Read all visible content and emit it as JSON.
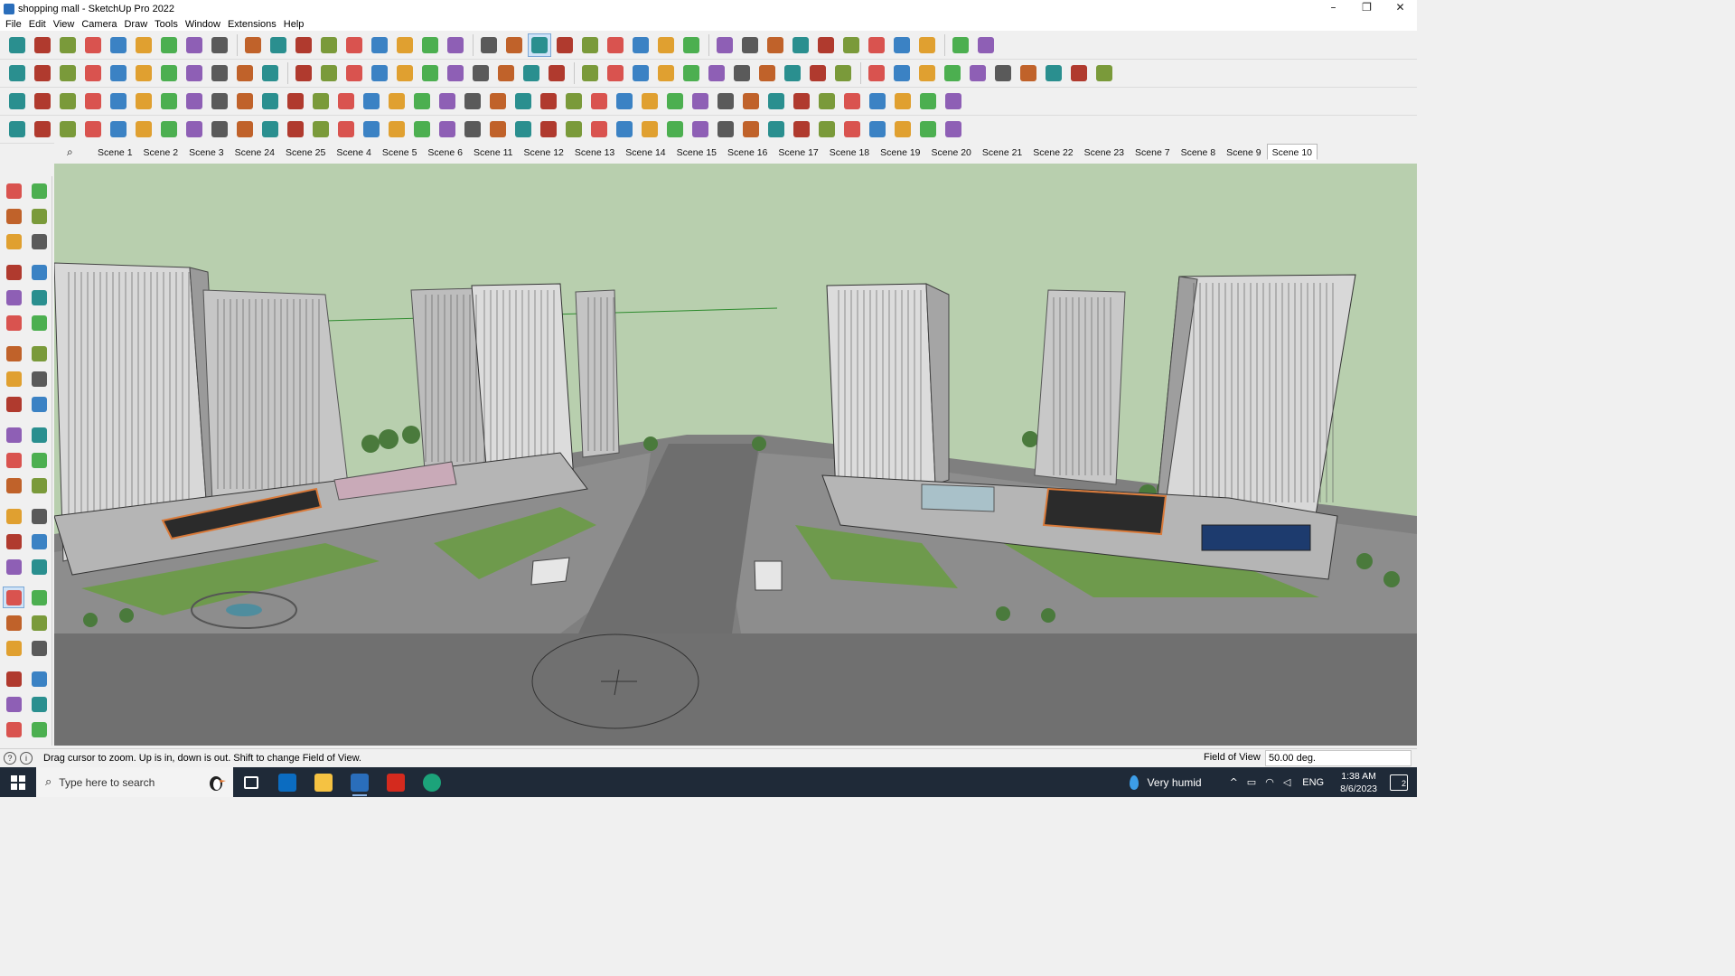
{
  "window": {
    "title": "shopping mall - SketchUp Pro 2022",
    "controls": [
      "–",
      "❐",
      "✕"
    ]
  },
  "menu": [
    "File",
    "Edit",
    "View",
    "Camera",
    "Draw",
    "Tools",
    "Window",
    "Extensions",
    "Help"
  ],
  "toolbars": {
    "row1_icons": [
      "zoom-search-icon",
      "select-icon",
      "select-dropdown-icon",
      "eraser-icon",
      "pencil-icon",
      "pencil-dropdown-icon",
      "freehand-icon",
      "freehand-dropdown-icon",
      "rectangle-icon",
      "rectangle-dropdown-icon",
      "push-pull-icon",
      "follow-me-icon",
      "move-icon",
      "rotate-icon",
      "scale-icon",
      "tape-measure-icon",
      "text-icon",
      "paint-bucket-icon",
      "orbit-icon",
      "pan-icon",
      "zoom-icon",
      "zoom-extents-icon",
      "warehouse-icon",
      "sandbox-icon",
      "layers-icon",
      "components-icon",
      "user-account-icon",
      "user-dropdown-icon",
      "flag-icon",
      "style-icon",
      "axes-icon",
      "push-up-icon",
      "push-down-icon",
      "measure-icon",
      "section-icon",
      "undo-icon",
      "redo-icon",
      "eraser-red-icon"
    ],
    "row2_icons": [
      "cube-yellow-icon",
      "cube-gray-icon",
      "cube-tan-icon",
      "extrude-icon",
      "extrude-alt-icon",
      "extrude-blue-icon",
      "extrude-green-icon",
      "extrude-red-icon",
      "extrude-orange-icon",
      "extrude-purple-icon",
      "curve-icon",
      "section-plane-icon",
      "section-cut-icon",
      "section-fill-icon",
      "terrain-icon",
      "tree-icon",
      "house-icon",
      "house-alt-icon",
      "house-outline-icon",
      "garage-icon",
      "building-icon",
      "text-fx-icon",
      "tag-icon",
      "ruler-icon",
      "shape-a-icon",
      "circle-icon",
      "pentagon-icon",
      "ellipse-icon",
      "parallelogram-icon",
      "arc-shape-icon",
      "polygon-icon",
      "star-icon",
      "loop-icon",
      "spiral-icon",
      "line-red-icon",
      "eraser-pink-icon",
      "brick-icon",
      "grid-icon",
      "shape-tool-icon",
      "shape-tool-alt-icon",
      "shape-tool-glove-icon",
      "shape-tool-dark-icon",
      "shape-tool-red-icon"
    ],
    "row3_icons": [
      "solid-red-icon",
      "solid-blue-icon",
      "solid-yellow-icon",
      "solid-green-icon",
      "solid-red-alt-icon",
      "solid-white-icon",
      "arc-orange-icon",
      "box-red-icon",
      "panel-icon",
      "wood-icon",
      "pipe-icon",
      "bend-icon",
      "nodes-icon",
      "plus-red-icon",
      "plus-green-icon",
      "x-blue-icon",
      "lamp-icon",
      "cone-icon",
      "triangle-icon",
      "loop-orange-icon",
      "loop-x-icon",
      "ring-icon",
      "star-blue-icon",
      "bucket-icon",
      "magnet-icon",
      "tree-green-icon",
      "chain-icon",
      "plugin-a-icon",
      "plugin-b-icon",
      "plugin-c-icon",
      "cog-icon",
      "frame-icon",
      "grid-orange-icon",
      "grid-orange-alt-icon",
      "grid-yellow-icon",
      "points-red-icon",
      "circle-dots-icon",
      "blocks-icon"
    ],
    "row4_icons": [
      "edit-node-icon",
      "spline-icon",
      "curve-red-icon",
      "cross-line-icon",
      "weld-icon",
      "rotate-3d-icon",
      "tube-icon",
      "mesh-icon",
      "twist-icon",
      "corner-a-icon",
      "corner-b-icon",
      "line-cut-icon",
      "slice-icon",
      "knife-icon",
      "stairs-icon",
      "rail-icon",
      "hand-icon",
      "shell-icon",
      "leaf-icon",
      "stack-icon",
      "fence-icon",
      "ramp-a-icon",
      "ramp-b-icon",
      "ramp-c-icon",
      "tile-a-icon",
      "tile-b-icon",
      "wall-a-icon",
      "wall-b-icon",
      "wall-c-icon",
      "hatch-a-icon",
      "hatch-b-icon",
      "hatch-c-icon",
      "hatch-d-icon",
      "hatch-e-icon",
      "hatch-f-icon",
      "hatch-g-icon",
      "hatch-h-icon",
      "cube-outline-icon"
    ]
  },
  "scenes": {
    "tabs": [
      "Scene 1",
      "Scene 2",
      "Scene 3",
      "Scene 24",
      "Scene 25",
      "Scene 4",
      "Scene 5",
      "Scene 6",
      "Scene 11",
      "Scene 12",
      "Scene 13",
      "Scene 14",
      "Scene 15",
      "Scene 16",
      "Scene 17",
      "Scene 18",
      "Scene 19",
      "Scene 20",
      "Scene 21",
      "Scene 22",
      "Scene 23",
      "Scene 7",
      "Scene 8",
      "Scene 9",
      "Scene 10"
    ],
    "active": "Scene 10"
  },
  "left_palette": [
    "select-icon",
    "orbit-icon",
    "paint-bucket-icon",
    "eraser-icon",
    "components-icon",
    "pencil-icon",
    "line-icon",
    "freehand-icon",
    "rectangle-icon",
    "rotated-rectangle-icon",
    "circle-icon",
    "polygon-icon",
    "arc-icon",
    "two-point-arc-icon",
    "pie-icon",
    "three-point-arc-icon",
    "move-icon",
    "push-pull-icon",
    "rotate-icon",
    "follow-me-icon",
    "scale-icon",
    "offset-icon",
    "tape-measure-icon",
    "dimension-icon",
    "protractor-icon",
    "text-icon",
    "axes-icon",
    "3d-text-icon",
    "orbit-tool-icon",
    "pan-icon",
    "zoom-icon",
    "zoom-window-icon",
    "zoom-extents-icon",
    "previous-view-icon",
    "position-camera-icon",
    "look-around-icon",
    "walk-icon",
    "section-plane-icon",
    "warehouse-icon",
    "sandbox-icon",
    "extension-warehouse-icon",
    "layout-icon"
  ],
  "status": {
    "message": "Drag cursor to zoom.  Up is in, down is out. Shift to change Field of View.",
    "fov_label": "Field of View",
    "fov_value": "50.00 deg."
  },
  "taskbar": {
    "search_placeholder": "Type here to search",
    "weather": "Very humid",
    "language": "ENG",
    "time": "1:38 AM",
    "date": "8/6/2023",
    "notification_count": "2"
  },
  "colors": {
    "sky": "#b8cfae",
    "road": "#6e6e6e",
    "ground": "#7f7f7f",
    "grass": "#6e9a4c",
    "building": "#d8d8d8",
    "accent_orange": "#d97a3a",
    "taskbar": "#1f2a38"
  }
}
